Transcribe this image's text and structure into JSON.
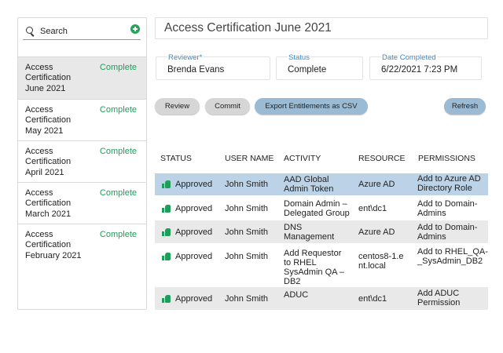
{
  "sidebar": {
    "search_placeholder": "Search",
    "items": [
      {
        "name": "Access Certification June 2021",
        "status": "Complete"
      },
      {
        "name": "Access Certification May 2021",
        "status": "Complete"
      },
      {
        "name": "Access Certification April 2021",
        "status": "Complete"
      },
      {
        "name": "Access Certification March 2021",
        "status": "Complete"
      },
      {
        "name": "Access Certification February 2021",
        "status": "Complete"
      }
    ]
  },
  "header": {
    "title": "Access Certification June 2021",
    "reviewer_label": "Reviewer*",
    "reviewer_value": "Brenda Evans",
    "status_label": "Status",
    "status_value": "Complete",
    "date_label": "Date Completed",
    "date_value": "6/22/2021 7:23 PM"
  },
  "toolbar": {
    "review": "Review",
    "commit": "Commit",
    "export": "Export Entitlements as CSV",
    "refresh": "Refresh"
  },
  "table": {
    "columns": [
      "STATUS",
      "USER NAME",
      "ACTIVITY",
      "RESOURCE",
      "PERMISSIONS"
    ],
    "rows": [
      {
        "status": "Approved",
        "user": "John Smith",
        "activity": "AAD Global Admin Token",
        "resource": "Azure AD",
        "permissions": "Add to Azure AD Directory Role"
      },
      {
        "status": "Approved",
        "user": "John Smith",
        "activity": "Domain Admin – Delegated Group",
        "resource": "ent\\dc1",
        "permissions": "Add to Domain-Admins"
      },
      {
        "status": "Approved",
        "user": "John Smith",
        "activity": "DNS Management",
        "resource": "Azure AD",
        "permissions": "Add to Domain-Admins"
      },
      {
        "status": "Approved",
        "user": "John Smith",
        "activity": "Add Requestor to RHEL SysAdmin QA – DB2",
        "resource": "centos8-1.ent.local",
        "permissions": "Add to RHEL_QA-_SysAdmin_DB2"
      },
      {
        "status": "Approved",
        "user": "John Smith",
        "activity": "ADUC",
        "resource": "ent\\dc1",
        "permissions": "Add ADUC Permission"
      }
    ]
  },
  "colors": {
    "accent_green": "#1e9e5a",
    "label_blue": "#3d86c6",
    "selected_row": "#bcd3e7",
    "button_blue": "#9bbbd4"
  }
}
